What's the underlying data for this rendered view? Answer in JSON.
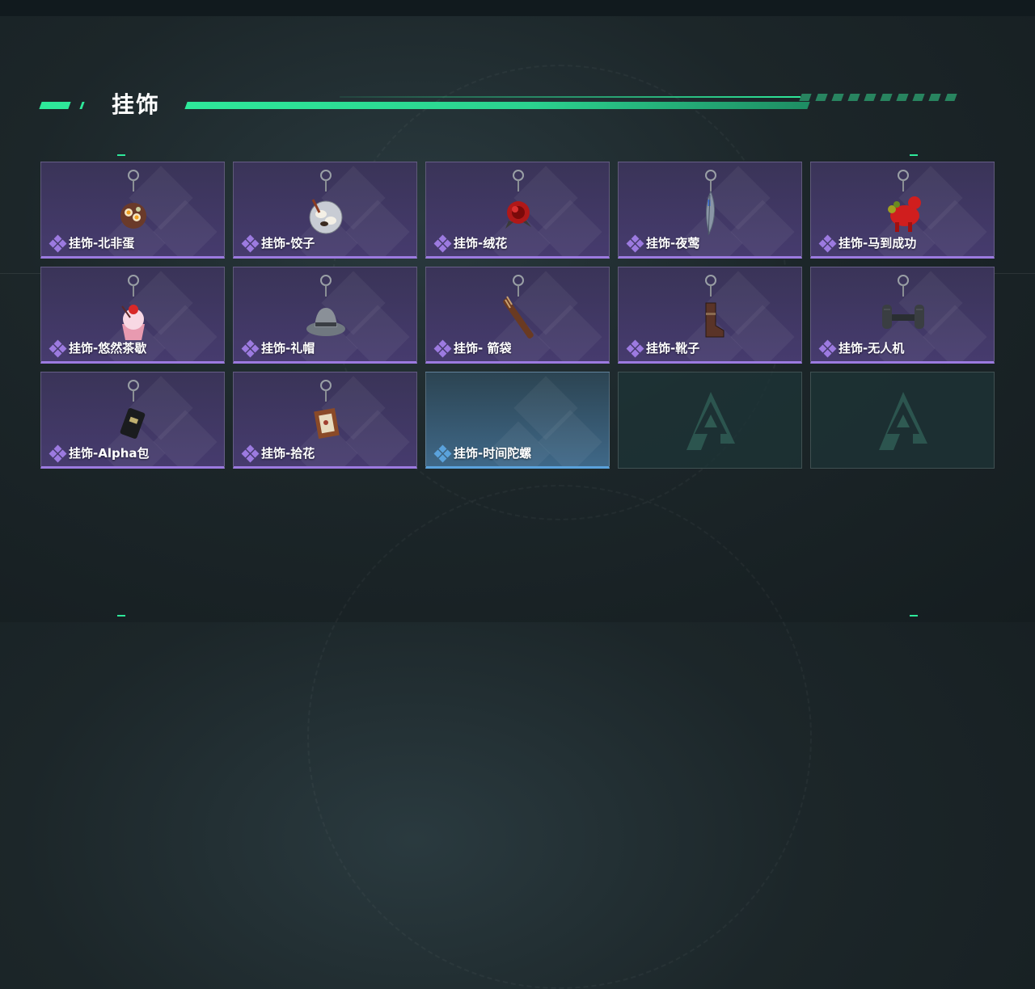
{
  "section": {
    "title": "挂饰"
  },
  "colors": {
    "accent": "#2ee89a",
    "purple_rarity": "#9c7ae0",
    "blue_rarity": "#5aa2dc"
  },
  "slots": [
    {
      "label": "挂饰-北非蛋",
      "rarity": "purple",
      "icon": "egg-dish-charm-icon"
    },
    {
      "label": "挂饰-饺子",
      "rarity": "purple",
      "icon": "dumpling-plate-charm-icon"
    },
    {
      "label": "挂饰-绒花",
      "rarity": "purple",
      "icon": "red-velvet-flower-charm-icon"
    },
    {
      "label": "挂饰-夜莺",
      "rarity": "purple",
      "icon": "feather-charm-icon"
    },
    {
      "label": "挂饰-马到成功",
      "rarity": "purple",
      "icon": "red-horse-charm-icon"
    },
    {
      "label": "挂饰-悠然茶歇",
      "rarity": "purple",
      "icon": "cupcake-charm-icon"
    },
    {
      "label": "挂饰-礼帽",
      "rarity": "purple",
      "icon": "fedora-hat-charm-icon"
    },
    {
      "label": "挂饰- 箭袋",
      "rarity": "purple",
      "icon": "quiver-charm-icon"
    },
    {
      "label": "挂饰-靴子",
      "rarity": "purple",
      "icon": "boot-charm-icon"
    },
    {
      "label": "挂饰-无人机",
      "rarity": "purple",
      "icon": "drone-charm-icon"
    },
    {
      "label": "挂饰-Alpha包",
      "rarity": "purple",
      "icon": "black-pouch-charm-icon"
    },
    {
      "label": "挂饰-拾花",
      "rarity": "purple",
      "icon": "picture-frame-charm-icon"
    },
    {
      "label": "挂饰-时间陀螺",
      "rarity": "blue",
      "icon": ""
    },
    {
      "label": "",
      "rarity": "empty",
      "icon": "empty-slot-logo-icon"
    },
    {
      "label": "",
      "rarity": "empty",
      "icon": "empty-slot-logo-icon"
    }
  ]
}
